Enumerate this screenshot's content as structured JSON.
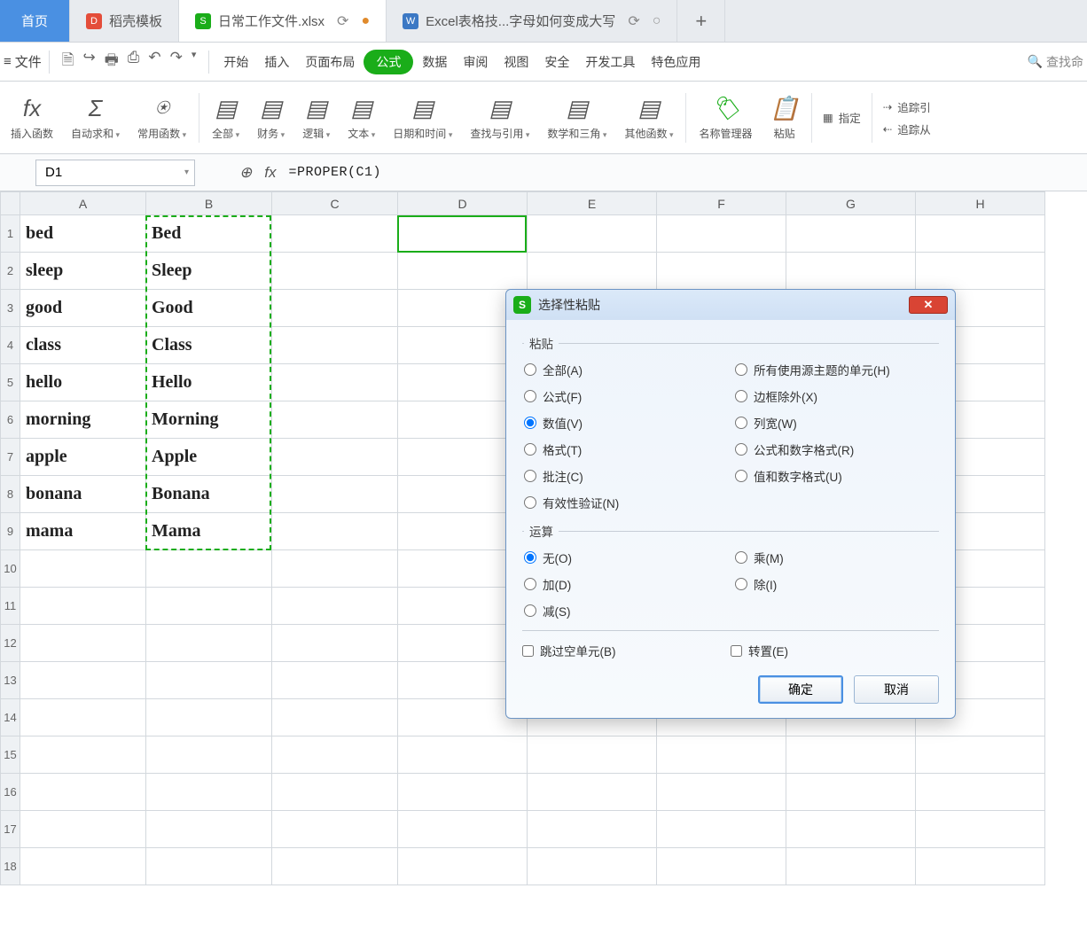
{
  "tabs": {
    "home": "首页",
    "t1": "稻壳模板",
    "t2": "日常工作文件.xlsx",
    "t3": "Excel表格技...字母如何变成大写"
  },
  "menu": {
    "file": "文件",
    "items": [
      "开始",
      "插入",
      "页面布局",
      "公式",
      "数据",
      "审阅",
      "视图",
      "安全",
      "开发工具",
      "特色应用"
    ],
    "search": "查找命"
  },
  "ribbon": {
    "g0": "插入函数",
    "g1": "自动求和",
    "g2": "常用函数",
    "g3": "全部",
    "g4": "财务",
    "g5": "逻辑",
    "g6": "文本",
    "g7": "日期和时间",
    "g8": "查找与引用",
    "g9": "数学和三角",
    "g10": "其他函数",
    "g11": "名称管理器",
    "g12": "粘贴",
    "r1": "指定",
    "r2": "追踪引",
    "r3": "追踪从"
  },
  "namebox": "D1",
  "formula": "=PROPER(C1)",
  "columns": [
    "A",
    "B",
    "C",
    "D",
    "E",
    "F",
    "G",
    "H"
  ],
  "rows": [
    {
      "a": "bed",
      "b": "Bed"
    },
    {
      "a": "sleep",
      "b": "Sleep"
    },
    {
      "a": "good",
      "b": "Good"
    },
    {
      "a": "class",
      "b": "Class"
    },
    {
      "a": "hello",
      "b": "Hello"
    },
    {
      "a": "morning",
      "b": "Morning"
    },
    {
      "a": "apple",
      "b": "Apple"
    },
    {
      "a": "bonana",
      "b": "Bonana"
    },
    {
      "a": "mama",
      "b": "Mama"
    }
  ],
  "dialog": {
    "title": "选择性粘贴",
    "fs1": "粘贴",
    "fs2": "运算",
    "paste_opts_left": [
      "全部(A)",
      "公式(F)",
      "数值(V)",
      "格式(T)",
      "批注(C)",
      "有效性验证(N)"
    ],
    "paste_opts_right": [
      "所有使用源主题的单元(H)",
      "边框除外(X)",
      "列宽(W)",
      "公式和数字格式(R)",
      "值和数字格式(U)"
    ],
    "op_left": [
      "无(O)",
      "加(D)",
      "减(S)"
    ],
    "op_right": [
      "乘(M)",
      "除(I)"
    ],
    "skip": "跳过空单元(B)",
    "trans": "转置(E)",
    "ok": "确定",
    "cancel": "取消"
  }
}
